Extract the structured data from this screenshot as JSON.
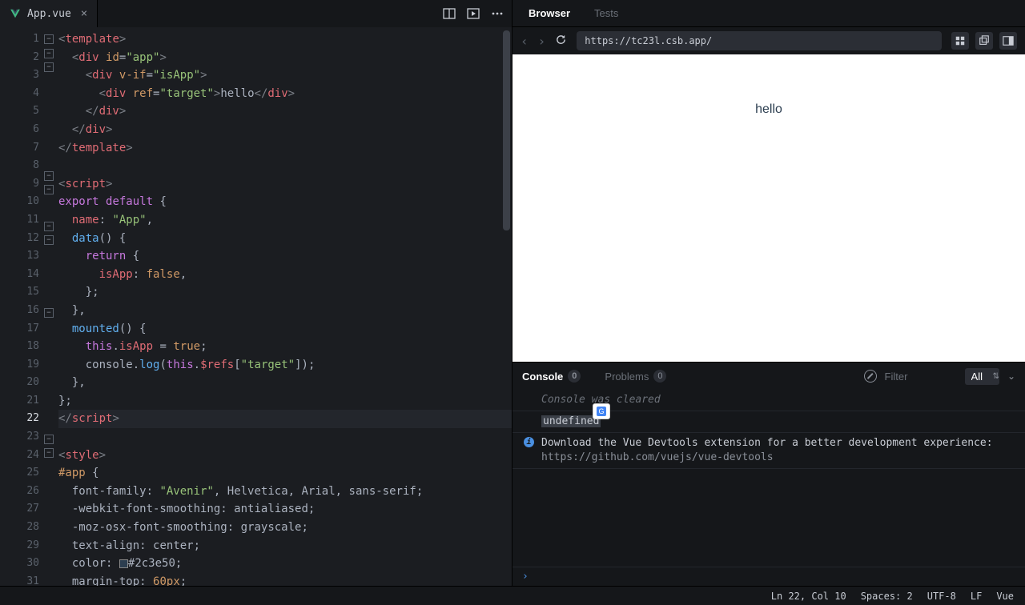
{
  "editor": {
    "tab": {
      "filename": "App.vue"
    },
    "active_line": 22,
    "lines": [
      {
        "n": 1,
        "fold": true,
        "html": "<span class='tok-angle'>&lt;</span><span class='tok-tag'>template</span><span class='tok-angle'>&gt;</span>"
      },
      {
        "n": 2,
        "fold": true,
        "html": "  <span class='tok-angle'>&lt;</span><span class='tok-tag'>div</span> <span class='tok-attr'>id</span><span class='tok-punc'>=</span><span class='tok-str'>\"app\"</span><span class='tok-angle'>&gt;</span>"
      },
      {
        "n": 3,
        "fold": true,
        "html": "    <span class='tok-angle'>&lt;</span><span class='tok-tag'>div</span> <span class='tok-attr'>v-if</span><span class='tok-punc'>=</span><span class='tok-str'>\"isApp\"</span><span class='tok-angle'>&gt;</span>"
      },
      {
        "n": 4,
        "fold": false,
        "html": "      <span class='tok-angle'>&lt;</span><span class='tok-tag'>div</span> <span class='tok-attr'>ref</span><span class='tok-punc'>=</span><span class='tok-str'>\"target\"</span><span class='tok-angle'>&gt;</span><span class='tok-txt'>hello</span><span class='tok-angle'>&lt;/</span><span class='tok-tag'>div</span><span class='tok-angle'>&gt;</span>"
      },
      {
        "n": 5,
        "fold": false,
        "html": "    <span class='tok-angle'>&lt;/</span><span class='tok-tag'>div</span><span class='tok-angle'>&gt;</span>"
      },
      {
        "n": 6,
        "fold": false,
        "html": "  <span class='tok-angle'>&lt;/</span><span class='tok-tag'>div</span><span class='tok-angle'>&gt;</span>"
      },
      {
        "n": 7,
        "fold": false,
        "html": "<span class='tok-angle'>&lt;/</span><span class='tok-tag'>template</span><span class='tok-angle'>&gt;</span>"
      },
      {
        "n": 8,
        "fold": false,
        "html": ""
      },
      {
        "n": 9,
        "fold": true,
        "html": "<span class='tok-angle'>&lt;</span><span class='tok-tag'>script</span><span class='tok-angle'>&gt;</span>"
      },
      {
        "n": 10,
        "fold": true,
        "html": "<span class='tok-kw'>export</span> <span class='tok-kw'>default</span> <span class='tok-punc'>{</span>"
      },
      {
        "n": 11,
        "fold": false,
        "html": "  <span class='tok-prop'>name</span><span class='tok-punc'>:</span> <span class='tok-str'>\"App\"</span><span class='tok-punc'>,</span>"
      },
      {
        "n": 12,
        "fold": true,
        "html": "  <span class='tok-fn'>data</span><span class='tok-punc'>() {</span>"
      },
      {
        "n": 13,
        "fold": true,
        "html": "    <span class='tok-kw'>return</span> <span class='tok-punc'>{</span>"
      },
      {
        "n": 14,
        "fold": false,
        "html": "      <span class='tok-prop'>isApp</span><span class='tok-punc'>:</span> <span class='tok-bool'>false</span><span class='tok-punc'>,</span>"
      },
      {
        "n": 15,
        "fold": false,
        "html": "    <span class='tok-punc'>};</span>"
      },
      {
        "n": 16,
        "fold": false,
        "html": "  <span class='tok-punc'>},</span>"
      },
      {
        "n": 17,
        "fold": true,
        "html": "  <span class='tok-fn'>mounted</span><span class='tok-punc'>() {</span>"
      },
      {
        "n": 18,
        "fold": false,
        "html": "    <span class='tok-kw'>this</span><span class='tok-punc'>.</span><span class='tok-prop'>isApp</span> <span class='tok-punc'>=</span> <span class='tok-bool'>true</span><span class='tok-punc'>;</span>"
      },
      {
        "n": 19,
        "fold": false,
        "html": "    <span class='tok-txt'>console</span><span class='tok-punc'>.</span><span class='tok-fn'>log</span><span class='tok-punc'>(</span><span class='tok-kw'>this</span><span class='tok-punc'>.</span><span class='tok-prop'>$refs</span><span class='tok-punc'>[</span><span class='tok-str'>\"target\"</span><span class='tok-punc'>]);</span>"
      },
      {
        "n": 20,
        "fold": false,
        "html": "  <span class='tok-punc'>},</span>"
      },
      {
        "n": 21,
        "fold": false,
        "html": "<span class='tok-punc'>};</span>"
      },
      {
        "n": 22,
        "fold": false,
        "html": "<span class='tok-angle'>&lt;/</span><span class='tok-tag'>script</span><span class='tok-angle'>&gt;</span>"
      },
      {
        "n": 23,
        "fold": false,
        "html": ""
      },
      {
        "n": 24,
        "fold": true,
        "html": "<span class='tok-angle'>&lt;</span><span class='tok-tag'>style</span><span class='tok-angle'>&gt;</span>"
      },
      {
        "n": 25,
        "fold": true,
        "html": "<span class='tok-sel'>#app</span> <span class='tok-punc'>{</span>"
      },
      {
        "n": 26,
        "fold": false,
        "html": "  <span class='tok-txt'>font-family</span><span class='tok-punc'>:</span> <span class='tok-str'>\"Avenir\"</span><span class='tok-punc'>,</span> <span class='tok-txt'>Helvetica</span><span class='tok-punc'>,</span> <span class='tok-txt'>Arial</span><span class='tok-punc'>,</span> <span class='tok-txt'>sans-serif</span><span class='tok-punc'>;</span>"
      },
      {
        "n": 27,
        "fold": false,
        "html": "  <span class='tok-txt'>-webkit-font-smoothing</span><span class='tok-punc'>:</span> <span class='tok-txt'>antialiased</span><span class='tok-punc'>;</span>"
      },
      {
        "n": 28,
        "fold": false,
        "html": "  <span class='tok-txt'>-moz-osx-font-smoothing</span><span class='tok-punc'>:</span> <span class='tok-txt'>grayscale</span><span class='tok-punc'>;</span>"
      },
      {
        "n": 29,
        "fold": false,
        "html": "  <span class='tok-txt'>text-align</span><span class='tok-punc'>:</span> <span class='tok-txt'>center</span><span class='tok-punc'>;</span>"
      },
      {
        "n": 30,
        "fold": false,
        "html": "  <span class='tok-txt'>color</span><span class='tok-punc'>:</span> <span style='display:inline-block;width:11px;height:11px;background:#2c3e50;border:1px solid #888;vertical-align:middle;'></span><span class='tok-txt'>#2c3e50</span><span class='tok-punc'>;</span>"
      },
      {
        "n": 31,
        "fold": false,
        "html": "  <span class='tok-txt'>margin-top</span><span class='tok-punc'>:</span> <span class='tok-val'>60px</span><span class='tok-punc'>;</span>"
      }
    ]
  },
  "right": {
    "tabs": {
      "browser": "Browser",
      "tests": "Tests"
    },
    "url": "https://tc23l.csb.app/",
    "preview_text": "hello"
  },
  "console": {
    "tabs": {
      "console": "Console",
      "console_badge": "0",
      "problems": "Problems",
      "problems_badge": "0"
    },
    "filter_placeholder": "Filter",
    "level": "All",
    "rows": {
      "cleared": "Console was cleared",
      "undefined": "undefined",
      "info1": "Download the Vue Devtools extension for a better development experience:",
      "info2": "https://github.com/vuejs/vue-devtools"
    }
  },
  "status": {
    "pos": "Ln 22, Col 10",
    "spaces": "Spaces: 2",
    "enc": "UTF-8",
    "eol": "LF",
    "lang": "Vue"
  }
}
